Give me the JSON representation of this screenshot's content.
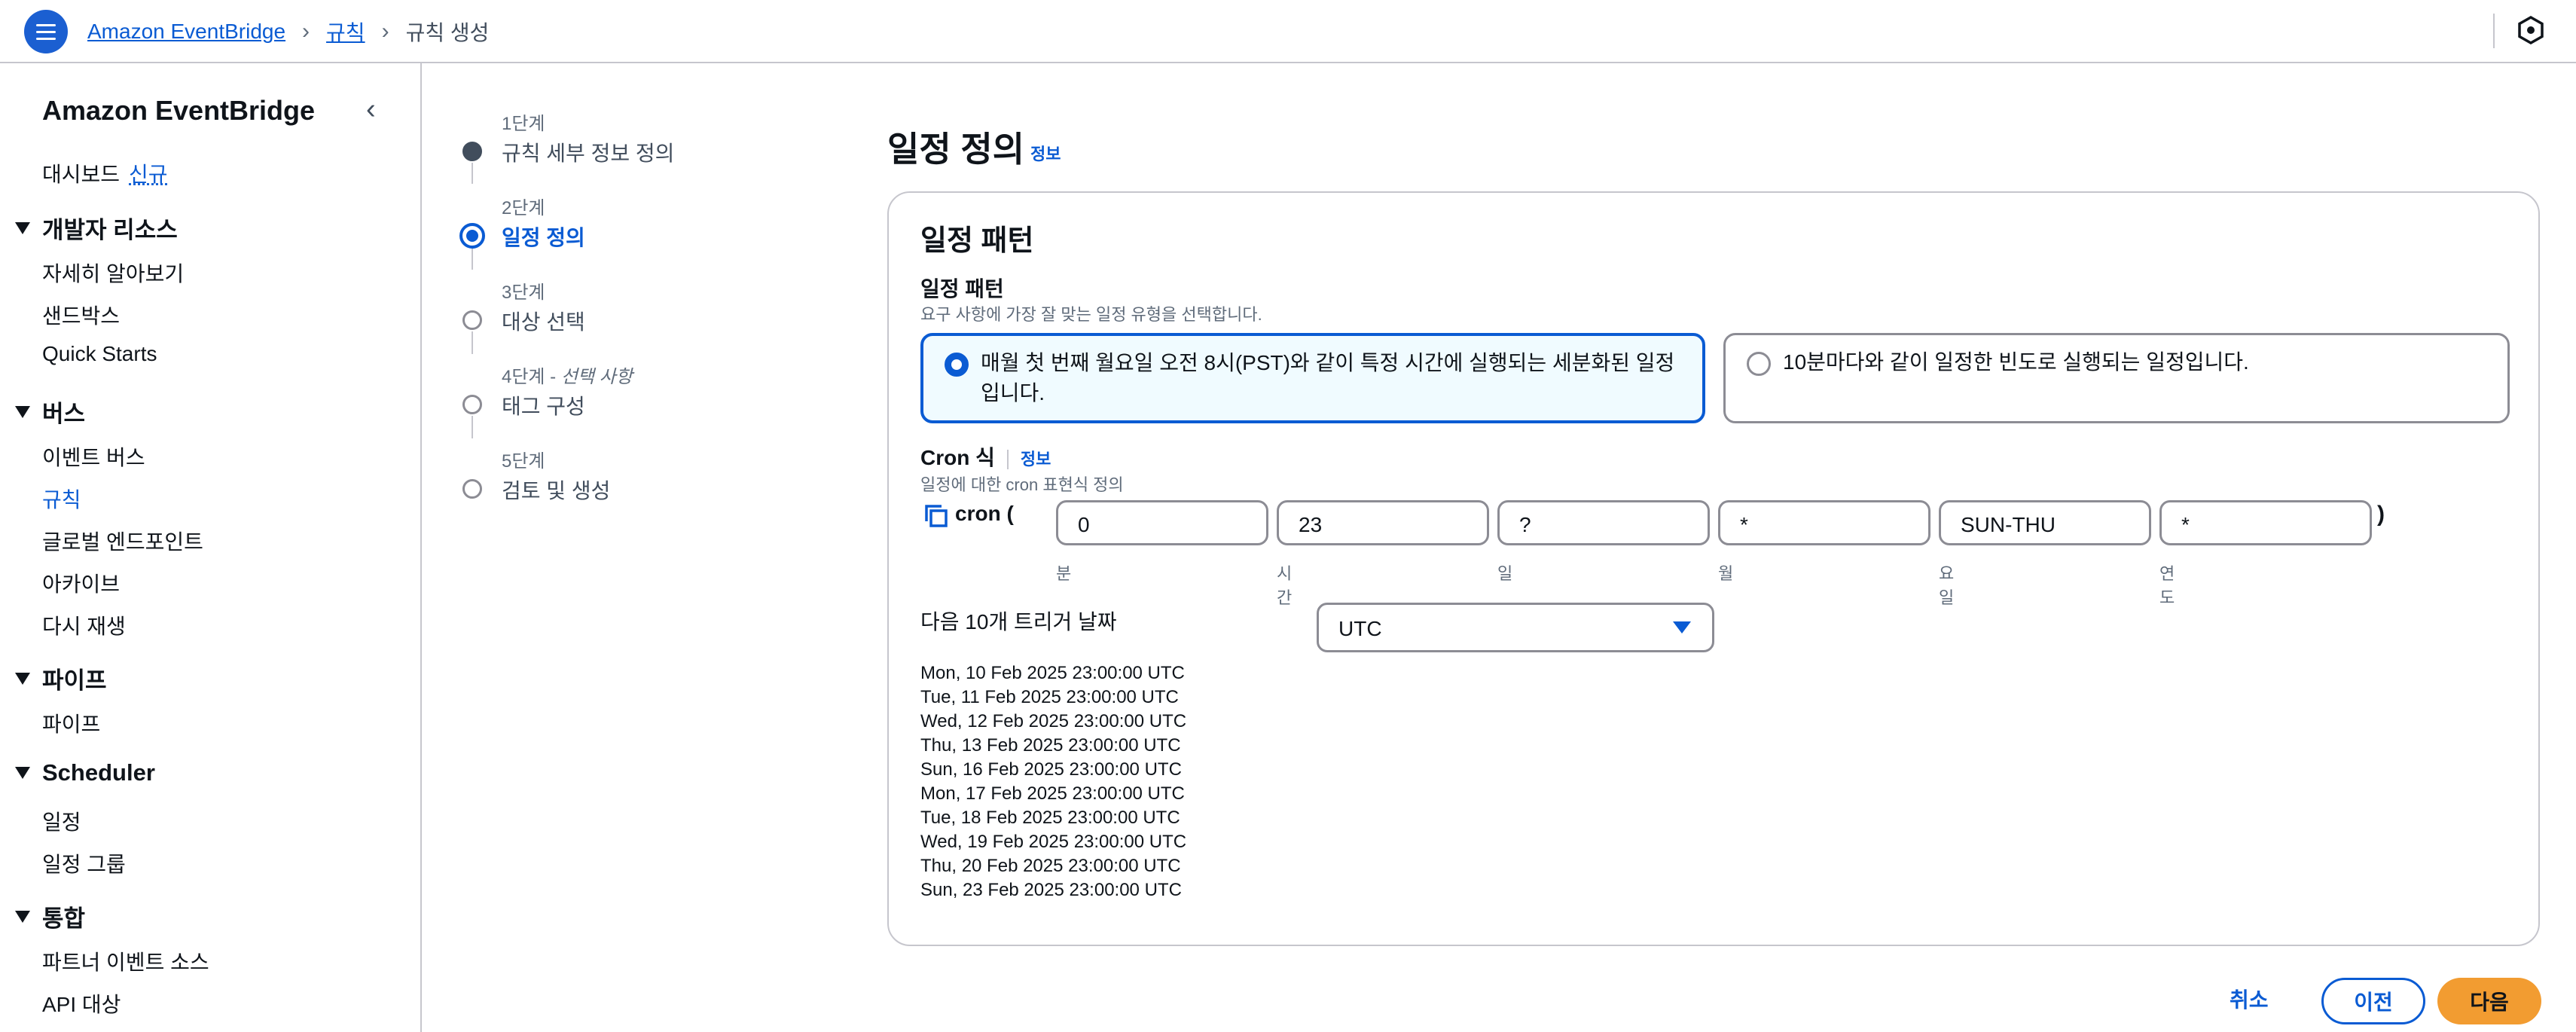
{
  "breadcrumb": {
    "home": "Amazon EventBridge",
    "rules": "규칙",
    "current": "규칙 생성"
  },
  "sidebar": {
    "title": "Amazon EventBridge",
    "dashboard": "대시보드",
    "new_badge": "신규",
    "sections": [
      {
        "title": "개발자 리소스",
        "items": [
          "자세히 알아보기",
          "샌드박스",
          "Quick Starts"
        ]
      },
      {
        "title": "버스",
        "items": [
          "이벤트 버스",
          "규칙",
          "글로벌 엔드포인트",
          "아카이브",
          "다시 재생"
        ]
      },
      {
        "title": "파이프",
        "items": [
          "파이프"
        ]
      },
      {
        "title": "Scheduler",
        "items": [
          "일정",
          "일정 그룹"
        ]
      },
      {
        "title": "통합",
        "items": [
          "파트너 이벤트 소스",
          "API 대상"
        ]
      }
    ],
    "active_item": "규칙"
  },
  "steps": [
    {
      "label": "1단계",
      "name": "규칙 세부 정보 정의",
      "state": "done"
    },
    {
      "label": "2단계",
      "name": "일정 정의",
      "state": "active"
    },
    {
      "label": "3단계",
      "name": "대상 선택",
      "state": "pending"
    },
    {
      "label": "4단계",
      "optional": "선택 사항",
      "name": "태그 구성",
      "state": "pending"
    },
    {
      "label": "5단계",
      "name": "검토 및 생성",
      "state": "pending"
    }
  ],
  "main": {
    "title": "일정 정의",
    "info": "정보",
    "card_title": "일정 패턴",
    "pattern_label": "일정 패턴",
    "pattern_desc": "요구 사항에 가장 잘 맞는 일정 유형을 선택합니다.",
    "option_fine": "매월 첫 번째 월요일 오전 8시(PST)와 같이 특정 시간에 실행되는 세분화된 일정입니다.",
    "option_rate": "10분마다와 같이 일정한 빈도로 실행되는 일정입니다.",
    "cron_label": "Cron 식",
    "cron_info": "정보",
    "cron_desc": "일정에 대한 cron 표현식 정의",
    "cron_prefix": "cron (",
    "cron_suffix": ")",
    "cron_fields": [
      {
        "value": "0",
        "label": "분"
      },
      {
        "value": "23",
        "label": "시간"
      },
      {
        "value": "?",
        "label": "일"
      },
      {
        "value": "*",
        "label": "월"
      },
      {
        "value": "SUN-THU",
        "label": "요일"
      },
      {
        "value": "*",
        "label": "연도"
      }
    ],
    "trigger_label": "다음 10개 트리거 날짜",
    "timezone": "UTC",
    "trigger_dates": [
      "Mon, 10 Feb 2025 23:00:00 UTC",
      "Tue, 11 Feb 2025 23:00:00 UTC",
      "Wed, 12 Feb 2025 23:00:00 UTC",
      "Thu, 13 Feb 2025 23:00:00 UTC",
      "Sun, 16 Feb 2025 23:00:00 UTC",
      "Mon, 17 Feb 2025 23:00:00 UTC",
      "Tue, 18 Feb 2025 23:00:00 UTC",
      "Wed, 19 Feb 2025 23:00:00 UTC",
      "Thu, 20 Feb 2025 23:00:00 UTC",
      "Sun, 23 Feb 2025 23:00:00 UTC"
    ]
  },
  "footer": {
    "cancel": "취소",
    "previous": "이전",
    "next": "다음"
  },
  "colors": {
    "accent": "#0a5bd3",
    "primary_button": "#f29c31",
    "border": "#8c8c94"
  }
}
